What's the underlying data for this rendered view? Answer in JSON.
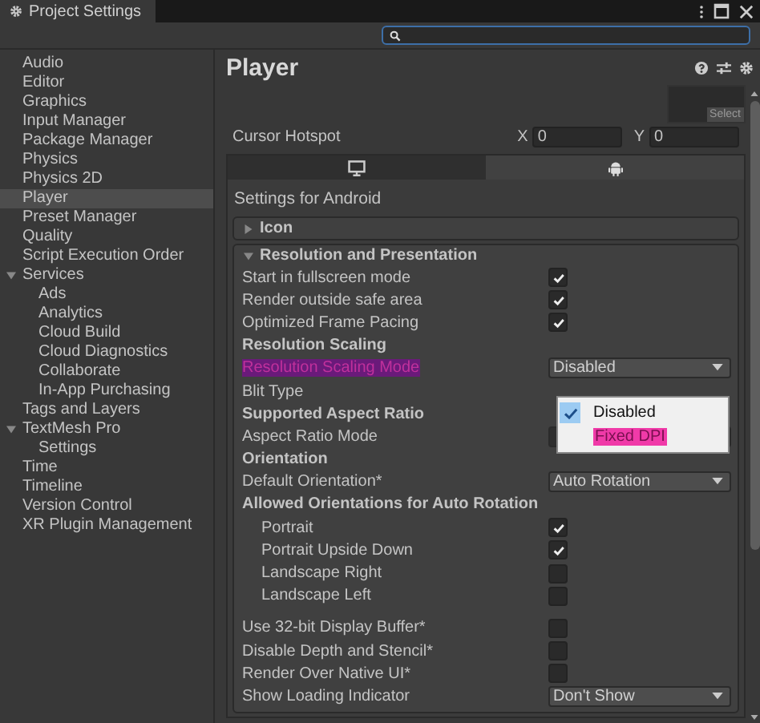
{
  "window": {
    "title": "Project Settings"
  },
  "sidebar": {
    "items": [
      {
        "label": "Audio",
        "selected": false
      },
      {
        "label": "Editor",
        "selected": false
      },
      {
        "label": "Graphics",
        "selected": false
      },
      {
        "label": "Input Manager",
        "selected": false
      },
      {
        "label": "Package Manager",
        "selected": false
      },
      {
        "label": "Physics",
        "selected": false
      },
      {
        "label": "Physics 2D",
        "selected": false
      },
      {
        "label": "Player",
        "selected": true
      },
      {
        "label": "Preset Manager",
        "selected": false
      },
      {
        "label": "Quality",
        "selected": false
      },
      {
        "label": "Script Execution Order",
        "selected": false
      },
      {
        "label": "Services",
        "selected": false,
        "expanded": true,
        "children": [
          {
            "label": "Ads",
            "selected": false
          },
          {
            "label": "Analytics",
            "selected": false
          },
          {
            "label": "Cloud Build",
            "selected": false
          },
          {
            "label": "Cloud Diagnostics",
            "selected": false
          },
          {
            "label": "Collaborate",
            "selected": false
          },
          {
            "label": "In-App Purchasing",
            "selected": false
          }
        ]
      },
      {
        "label": "Tags and Layers",
        "selected": false
      },
      {
        "label": "TextMesh Pro",
        "selected": false,
        "expanded": true,
        "children": [
          {
            "label": "Settings",
            "selected": false
          }
        ]
      },
      {
        "label": "Time",
        "selected": false
      },
      {
        "label": "Timeline",
        "selected": false
      },
      {
        "label": "Version Control",
        "selected": false
      },
      {
        "label": "XR Plugin Management",
        "selected": false
      }
    ]
  },
  "header": {
    "title": "Player"
  },
  "cursor_hotspot": {
    "label": "Cursor Hotspot",
    "select_label": "Select",
    "x_label": "X",
    "x_value": "0",
    "y_label": "Y",
    "y_value": "0"
  },
  "platform_tabs": [
    {
      "kind": "desktop",
      "selected": false
    },
    {
      "kind": "android",
      "selected": true
    }
  ],
  "settings_title": "Settings for Android",
  "sections": [
    {
      "title": "Icon",
      "expanded": false
    },
    {
      "title": "Resolution and Presentation",
      "expanded": true
    }
  ],
  "rows": [
    {
      "kind": "checkbox",
      "label": "Start in fullscreen mode",
      "checked": true
    },
    {
      "kind": "checkbox",
      "label": "Render outside safe area",
      "checked": true
    },
    {
      "kind": "checkbox",
      "label": "Optimized Frame Pacing",
      "checked": true
    },
    {
      "kind": "heading",
      "label": "Resolution Scaling"
    },
    {
      "kind": "dropdown",
      "label": "Resolution Scaling Mode",
      "value": "Disabled",
      "highlighted": true
    },
    {
      "kind": "label",
      "label": "Blit Type"
    },
    {
      "kind": "heading",
      "label": "Supported Aspect Ratio"
    },
    {
      "kind": "field",
      "label": "Aspect Ratio Mode"
    },
    {
      "kind": "heading",
      "label": "Orientation"
    },
    {
      "kind": "dropdown",
      "label": "Default Orientation*",
      "value": "Auto Rotation",
      "highlighted": false
    },
    {
      "kind": "heading",
      "label": "Allowed Orientations for Auto Rotation",
      "children": [
        {
          "kind": "checkbox",
          "label": "Portrait",
          "checked": true
        },
        {
          "kind": "checkbox",
          "label": "Portrait Upside Down",
          "checked": true
        },
        {
          "kind": "checkbox",
          "label": "Landscape Right",
          "checked": false
        },
        {
          "kind": "checkbox",
          "label": "Landscape Left",
          "checked": false
        }
      ]
    },
    {
      "kind": "gap"
    },
    {
      "kind": "checkbox",
      "label": "Use 32-bit Display Buffer*",
      "checked": false
    },
    {
      "kind": "checkbox",
      "label": "Disable Depth and Stencil*",
      "checked": false
    },
    {
      "kind": "checkbox",
      "label": "Render Over Native UI*",
      "checked": false
    },
    {
      "kind": "dropdown",
      "label": "Show Loading Indicator",
      "value": "Don't Show",
      "highlighted": false
    }
  ],
  "popup": {
    "options": [
      {
        "label": "Disabled",
        "selected": true,
        "highlighted": false
      },
      {
        "label": "Fixed DPI",
        "selected": false,
        "highlighted": true
      }
    ]
  }
}
